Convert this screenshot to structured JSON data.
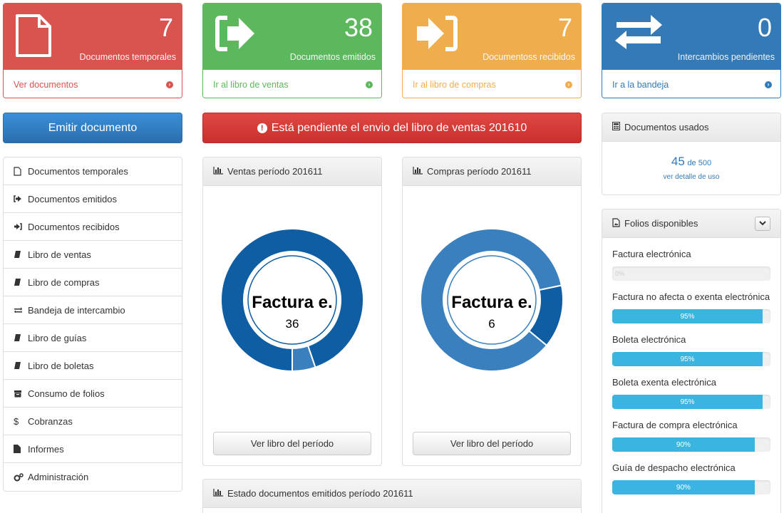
{
  "stats": [
    {
      "value": "7",
      "label": "Documentos temporales",
      "link": "Ver documentos",
      "icon": "file-icon"
    },
    {
      "value": "38",
      "label": "Documentos emitidos",
      "link": "Ir al libro de ventas",
      "icon": "sign-out-icon"
    },
    {
      "value": "7",
      "label": "Documentoss recibidos",
      "link": "Ir al libro de compras",
      "icon": "sign-in-icon"
    },
    {
      "value": "0",
      "label": "Intercambios pendientes",
      "link": "Ir a la bandeja",
      "icon": "exchange-icon"
    }
  ],
  "emit_button": "Emitir documento",
  "alert": "Está pendiente el envio del libro de ventas 201610",
  "menu": [
    {
      "label": "Documentos temporales",
      "icon": "file-o-icon"
    },
    {
      "label": "Documentos emitidos",
      "icon": "sign-out-icon"
    },
    {
      "label": "Documentos recibidos",
      "icon": "sign-in-icon"
    },
    {
      "label": "Libro de ventas",
      "icon": "book-icon"
    },
    {
      "label": "Libro de compras",
      "icon": "book-icon"
    },
    {
      "label": "Bandeja de intercambio",
      "icon": "exchange-icon"
    },
    {
      "label": "Libro de guías",
      "icon": "book-icon"
    },
    {
      "label": "Libro de boletas",
      "icon": "book-icon"
    },
    {
      "label": "Consumo de folios",
      "icon": "archive-icon"
    },
    {
      "label": "Cobranzas",
      "icon": "dollar-icon"
    },
    {
      "label": "Informes",
      "icon": "file-text-icon"
    },
    {
      "label": "Administración",
      "icon": "cogs-icon"
    }
  ],
  "ventas": {
    "title": "Ventas período 201611",
    "center_label": "Factura e.",
    "center_value": "36",
    "button": "Ver libro del período"
  },
  "compras": {
    "title": "Compras período 201611",
    "center_label": "Factura e.",
    "center_value": "6",
    "button": "Ver libro del período"
  },
  "estado": {
    "title": "Estado documentos emitidos período 201611"
  },
  "usados": {
    "title": "Documentos usados",
    "value": "45",
    "of": "de 500",
    "link": "ver detalle de uso"
  },
  "folios": {
    "title": "Folios disponibles",
    "items": [
      {
        "name": "Factura electrónica",
        "percent": 0,
        "label": "0%"
      },
      {
        "name": "Factura no afecta o exenta electrónica",
        "percent": 95,
        "label": "95%"
      },
      {
        "name": "Boleta electrónica",
        "percent": 95,
        "label": "95%"
      },
      {
        "name": "Boleta exenta electrónica",
        "percent": 95,
        "label": "95%"
      },
      {
        "name": "Factura de compra electrónica",
        "percent": 90,
        "label": "90%"
      },
      {
        "name": "Guía de despacho electrónica",
        "percent": 90,
        "label": "90%"
      }
    ]
  },
  "chart_data": [
    {
      "type": "pie",
      "title": "Ventas período 201611",
      "series": [
        {
          "values": [
            36,
            2
          ]
        }
      ],
      "colors": [
        "#0f5da3",
        "#3b80be"
      ]
    },
    {
      "type": "pie",
      "title": "Compras período 201611",
      "series": [
        {
          "values": [
            6,
            1
          ]
        }
      ],
      "colors": [
        "#3b80be",
        "#0f5da3"
      ]
    }
  ],
  "colors": {
    "red": "#d9534f",
    "green": "#5cb85c",
    "orange": "#f0ad4e",
    "blue": "#337ab7",
    "progress": "#3bb4e0"
  }
}
